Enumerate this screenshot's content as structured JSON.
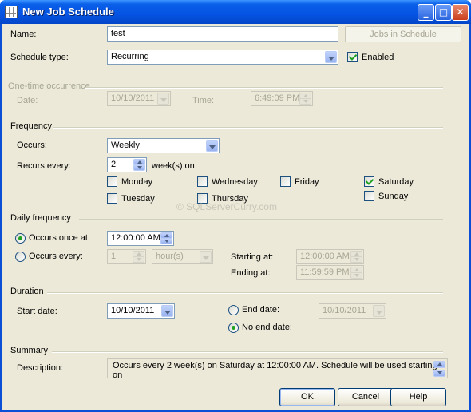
{
  "window": {
    "title": "New Job Schedule"
  },
  "name_row": {
    "label": "Name:",
    "value": "test",
    "jobs_button": "Jobs in Schedule"
  },
  "schedule_type": {
    "label": "Schedule type:",
    "value": "Recurring",
    "enabled_label": "Enabled",
    "enabled": true
  },
  "one_time": {
    "group": "One-time occurrence",
    "date_label": "Date:",
    "date": "10/10/2011",
    "time_label": "Time:",
    "time": "6:49:09 PM"
  },
  "frequency": {
    "group": "Frequency",
    "occurs_label": "Occurs:",
    "occurs": "Weekly",
    "recurs_label": "Recurs every:",
    "recurs_value": "2",
    "recurs_unit": "week(s) on",
    "days": [
      {
        "label": "Monday",
        "checked": false
      },
      {
        "label": "Tuesday",
        "checked": false
      },
      {
        "label": "Wednesday",
        "checked": false
      },
      {
        "label": "Thursday",
        "checked": false
      },
      {
        "label": "Friday",
        "checked": false
      },
      {
        "label": "Saturday",
        "checked": true
      },
      {
        "label": "Sunday",
        "checked": false
      }
    ]
  },
  "watermark": "© SQLServerCurry.com",
  "daily": {
    "group": "Daily frequency",
    "once_label": "Occurs once at:",
    "once_time": "12:00:00 AM",
    "every_label": "Occurs every:",
    "every_value": "1",
    "every_unit": "hour(s)",
    "starting_label": "Starting at:",
    "starting": "12:00:00 AM",
    "ending_label": "Ending at:",
    "ending": "11:59:59 PM"
  },
  "duration": {
    "group": "Duration",
    "start_label": "Start date:",
    "start_date": "10/10/2011",
    "end_label": "End date:",
    "end_date": "10/10/2011",
    "no_end_label": "No end date:"
  },
  "summary": {
    "group": "Summary",
    "desc_label": "Description:",
    "description": "Occurs every 2 week(s) on Saturday at 12:00:00 AM. Schedule will be used starting on"
  },
  "buttons": {
    "ok": "OK",
    "cancel": "Cancel",
    "help": "Help"
  },
  "colors": {
    "title_bar": "#0554e3",
    "dialog_bg": "#ece9d8",
    "check_green": "#21a121"
  }
}
